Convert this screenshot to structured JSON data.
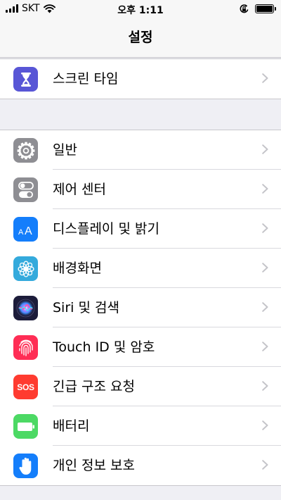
{
  "status_bar": {
    "carrier": "SKT",
    "time": "오후 1:11",
    "battery_level": 1.0,
    "icons": [
      "signal-bars-icon",
      "wifi-icon",
      "rotation-lock-icon",
      "battery-icon"
    ]
  },
  "nav": {
    "title": "설정"
  },
  "group1": [
    {
      "label": "스크린 타임",
      "icon": "hourglass-icon",
      "color": "#5856d6"
    }
  ],
  "group2": [
    {
      "label": "일반",
      "icon": "gear-icon",
      "color": "#8e8e93"
    },
    {
      "label": "제어 센터",
      "icon": "toggle-switches-icon",
      "color": "#8e8e93"
    },
    {
      "label": "디스플레이 및 밝기",
      "icon": "text-size-icon",
      "icon_text": "AA",
      "color": "#147efb"
    },
    {
      "label": "배경화면",
      "icon": "flower-icon",
      "color": "#34aadc"
    },
    {
      "label": "Siri 및 검색",
      "icon": "siri-icon",
      "color": "#1c1c3a"
    },
    {
      "label": "Touch ID 및 암호",
      "icon": "fingerprint-icon",
      "color": "#ff2d55"
    },
    {
      "label": "긴급 구조 요청",
      "icon": "sos-icon",
      "icon_text": "SOS",
      "color": "#ff3b30"
    },
    {
      "label": "배터리",
      "icon": "battery-icon",
      "color": "#4cd964"
    },
    {
      "label": "개인 정보 보호",
      "icon": "hand-icon",
      "color": "#147efb"
    }
  ]
}
